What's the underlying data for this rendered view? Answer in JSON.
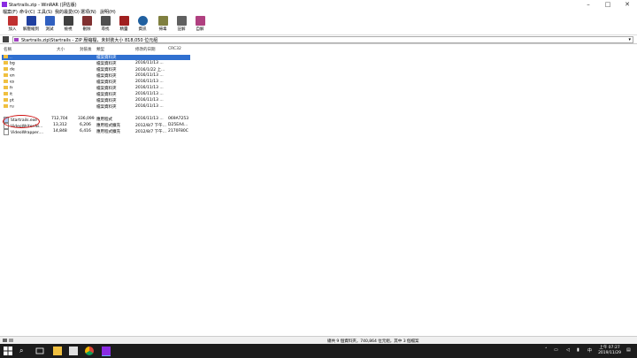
{
  "window": {
    "title": "Startrails.zip - WinRAR (評估版)"
  },
  "menu": [
    "檔案(F)",
    "命令(C)",
    "工具(S)",
    "我的最愛(O)",
    "選項(N)",
    "說明(H)"
  ],
  "toolbar": [
    {
      "label": "加入",
      "icon": "add-icon",
      "color": "#c03030"
    },
    {
      "label": "解壓縮到",
      "icon": "extract-to-icon",
      "color": "#2040a0"
    },
    {
      "label": "測試",
      "icon": "test-icon",
      "color": "#3060c0"
    },
    {
      "label": "檢視",
      "icon": "view-icon",
      "color": "#404040"
    },
    {
      "label": "刪除",
      "icon": "delete-icon",
      "color": "#803030"
    },
    {
      "label": "尋找",
      "icon": "find-icon",
      "color": "#505050"
    },
    {
      "label": "精靈",
      "icon": "wizard-icon",
      "color": "#a02020"
    },
    {
      "label": "資訊",
      "icon": "info-icon",
      "color": "#2060a0"
    },
    {
      "label": "掃毒",
      "icon": "virus-scan-icon",
      "color": "#808040"
    },
    {
      "label": "註解",
      "icon": "comment-icon",
      "color": "#606060"
    },
    {
      "label": "自解",
      "icon": "sfx-icon",
      "color": "#b04080"
    }
  ],
  "address": {
    "text": "Startrails.zip\\Startrails - ZIP 壓縮檔，未封裝大小 818,050 位元組"
  },
  "columns": [
    "名稱",
    "大小",
    "封裝後",
    "類型",
    "修改的日期",
    "CRC32"
  ],
  "rows": [
    {
      "name": "..",
      "size": "",
      "packed": "",
      "type": "檔案資料夾",
      "date": "",
      "crc": "",
      "kind": "up",
      "selected": true
    },
    {
      "name": "bg",
      "size": "",
      "packed": "",
      "type": "檔案資料夾",
      "date": "2016/11/13 ...",
      "crc": "",
      "kind": "folder"
    },
    {
      "name": "de",
      "size": "",
      "packed": "",
      "type": "檔案資料夾",
      "date": "2016/1/22 上...",
      "crc": "",
      "kind": "folder"
    },
    {
      "name": "en",
      "size": "",
      "packed": "",
      "type": "檔案資料夾",
      "date": "2016/11/13 ...",
      "crc": "",
      "kind": "folder"
    },
    {
      "name": "es",
      "size": "",
      "packed": "",
      "type": "檔案資料夾",
      "date": "2016/11/13 ...",
      "crc": "",
      "kind": "folder"
    },
    {
      "name": "fr",
      "size": "",
      "packed": "",
      "type": "檔案資料夾",
      "date": "2016/11/13 ...",
      "crc": "",
      "kind": "folder"
    },
    {
      "name": "it",
      "size": "",
      "packed": "",
      "type": "檔案資料夾",
      "date": "2016/11/13 ...",
      "crc": "",
      "kind": "folder"
    },
    {
      "name": "pt",
      "size": "",
      "packed": "",
      "type": "檔案資料夾",
      "date": "2016/11/13 ...",
      "crc": "",
      "kind": "folder"
    },
    {
      "name": "ru",
      "size": "",
      "packed": "",
      "type": "檔案資料夾",
      "date": "2016/11/13 ...",
      "crc": "",
      "kind": "folder"
    },
    {
      "name": "Startrails.exe",
      "size": "712,704",
      "packed": "336,099",
      "type": "應用程式",
      "date": "2016/11/13 ...",
      "crc": "069A7253",
      "kind": "exe"
    },
    {
      "name": "VideoWriter.Ni...",
      "size": "13,312",
      "packed": "6,206",
      "type": "應用程式擴充",
      "date": "2012/8/7 下午...",
      "crc": "D25EA4...",
      "kind": "dll"
    },
    {
      "name": "VideoWrapper....",
      "size": "14,848",
      "packed": "6,416",
      "type": "應用程式擴充",
      "date": "2012/8/7 下午...",
      "crc": "2170F80C",
      "kind": "dll"
    }
  ],
  "status": {
    "text": "總共 9 個資料夾，740,864 位元組，其中 3 個檔案"
  },
  "clock": {
    "time": "上午 07:27",
    "date": "2019/11/29"
  },
  "colors": {
    "selection": "#3070d0",
    "highlight_circle": "#d01010",
    "taskbar": "#1c1c1c"
  }
}
